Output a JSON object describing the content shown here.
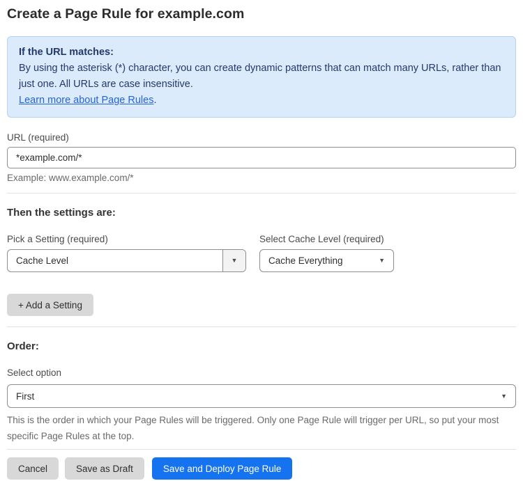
{
  "page": {
    "title": "Create a Page Rule for example.com"
  },
  "info_box": {
    "heading": "If the URL matches:",
    "body": "By using the asterisk (*) character, you can create dynamic patterns that can match many URLs, rather than just one. All URLs are case insensitive.",
    "link_label": "Learn more about Page Rules",
    "link_suffix": "."
  },
  "url_field": {
    "label": "URL (required)",
    "value": "*example.com/*",
    "hint": "Example: www.example.com/*"
  },
  "settings_section": {
    "heading": "Then the settings are:",
    "setting_picker": {
      "label": "Pick a Setting (required)",
      "value": "Cache Level"
    },
    "cache_level_picker": {
      "label": "Select Cache Level (required)",
      "value": "Cache Everything"
    },
    "add_setting_label": "+ Add a Setting",
    "caret_glyph": "▼"
  },
  "order_section": {
    "heading": "Order:",
    "label": "Select option",
    "value": "First",
    "description": "This is the order in which your Page Rules will be triggered. Only one Page Rule will trigger per URL, so put your most specific Page Rules at the top.",
    "caret_glyph": "▼"
  },
  "actions": {
    "cancel_label": "Cancel",
    "save_draft_label": "Save as Draft",
    "save_deploy_label": "Save and Deploy Page Rule"
  },
  "colors": {
    "primary_blue": "#1673f0",
    "info_background": "#dcebfb",
    "info_border": "#b7d2f0",
    "info_text": "#23386b",
    "link_blue": "#2563d9",
    "gray_button": "#d8d8d8"
  }
}
